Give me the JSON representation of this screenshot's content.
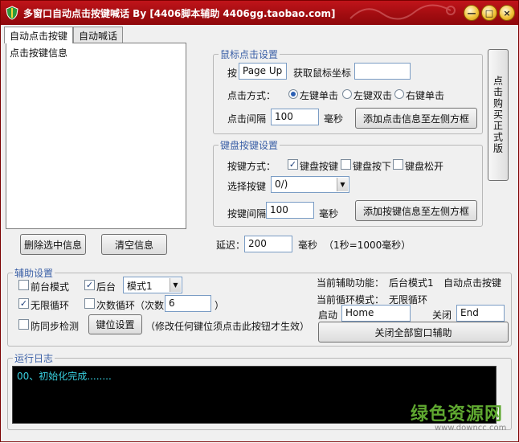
{
  "window": {
    "title": "多窗口自动点击按键喊话 By [4406脚本辅助 4406gg.taobao.com]",
    "controls": {
      "minimize": "—",
      "maximize": "□",
      "close": "×"
    }
  },
  "tabs": [
    {
      "label": "自动点击按键"
    },
    {
      "label": "自动喊话"
    }
  ],
  "list": {
    "header": "点击按键信息"
  },
  "mouse": {
    "legend": "鼠标点击设置",
    "key_label": "按",
    "key_value": "Page Up",
    "get_coords_label": "获取鼠标坐标",
    "coords_value": "",
    "click_mode_label": "点击方式：",
    "modes": [
      "左键单击",
      "左键双击",
      "右键单击"
    ],
    "selected_mode": 0,
    "interval_label": "点击间隔",
    "interval_value": "100",
    "interval_unit": "毫秒",
    "add_button": "添加点击信息至左侧方框"
  },
  "keyboard": {
    "legend": "键盘按键设置",
    "mode_label": "按键方式：",
    "modes": [
      "键盘按键",
      "键盘按下",
      "键盘松开"
    ],
    "checked": [
      true,
      false,
      false
    ],
    "select_label": "选择按键",
    "selected_key": "0/)",
    "interval_label": "按键间隔",
    "interval_value": "100",
    "interval_unit": "毫秒",
    "add_button": "添加按键信息至左侧方框"
  },
  "buy_button": "点击购买正式版",
  "delete_button": "删除选中信息",
  "clear_button": "清空信息",
  "delay": {
    "label": "延迟：",
    "value": "200",
    "unit": "毫秒",
    "note": "（1秒=1000毫秒）"
  },
  "assist": {
    "legend": "辅助设置",
    "foreground_mode": "前台模式",
    "background": "后台",
    "mode_select": "模式1",
    "infinite_loop": "无限循环",
    "count_loop": "次数循环（次数",
    "count_value": "6",
    "count_close": "）",
    "anti_sync": "防同步检测",
    "keybind_button": "键位设置",
    "keybind_note": "（修改任何键位须点击此按钮才生效）",
    "current_func_label": "当前辅助功能：",
    "current_func_mode": "后台模式1",
    "current_func_value": "自动点击按键",
    "current_loop_label": "当前循环模式：",
    "current_loop_value": "无限循环",
    "start_label": "启动",
    "start_key": "Home",
    "stop_label": "关闭",
    "stop_key": "End",
    "close_all_button": "关闭全部窗口辅助"
  },
  "log": {
    "legend": "运行日志",
    "lines": [
      "00、初始化完成........"
    ]
  },
  "watermark": {
    "text": "绿色资源网",
    "url": "www.downcc.com"
  }
}
